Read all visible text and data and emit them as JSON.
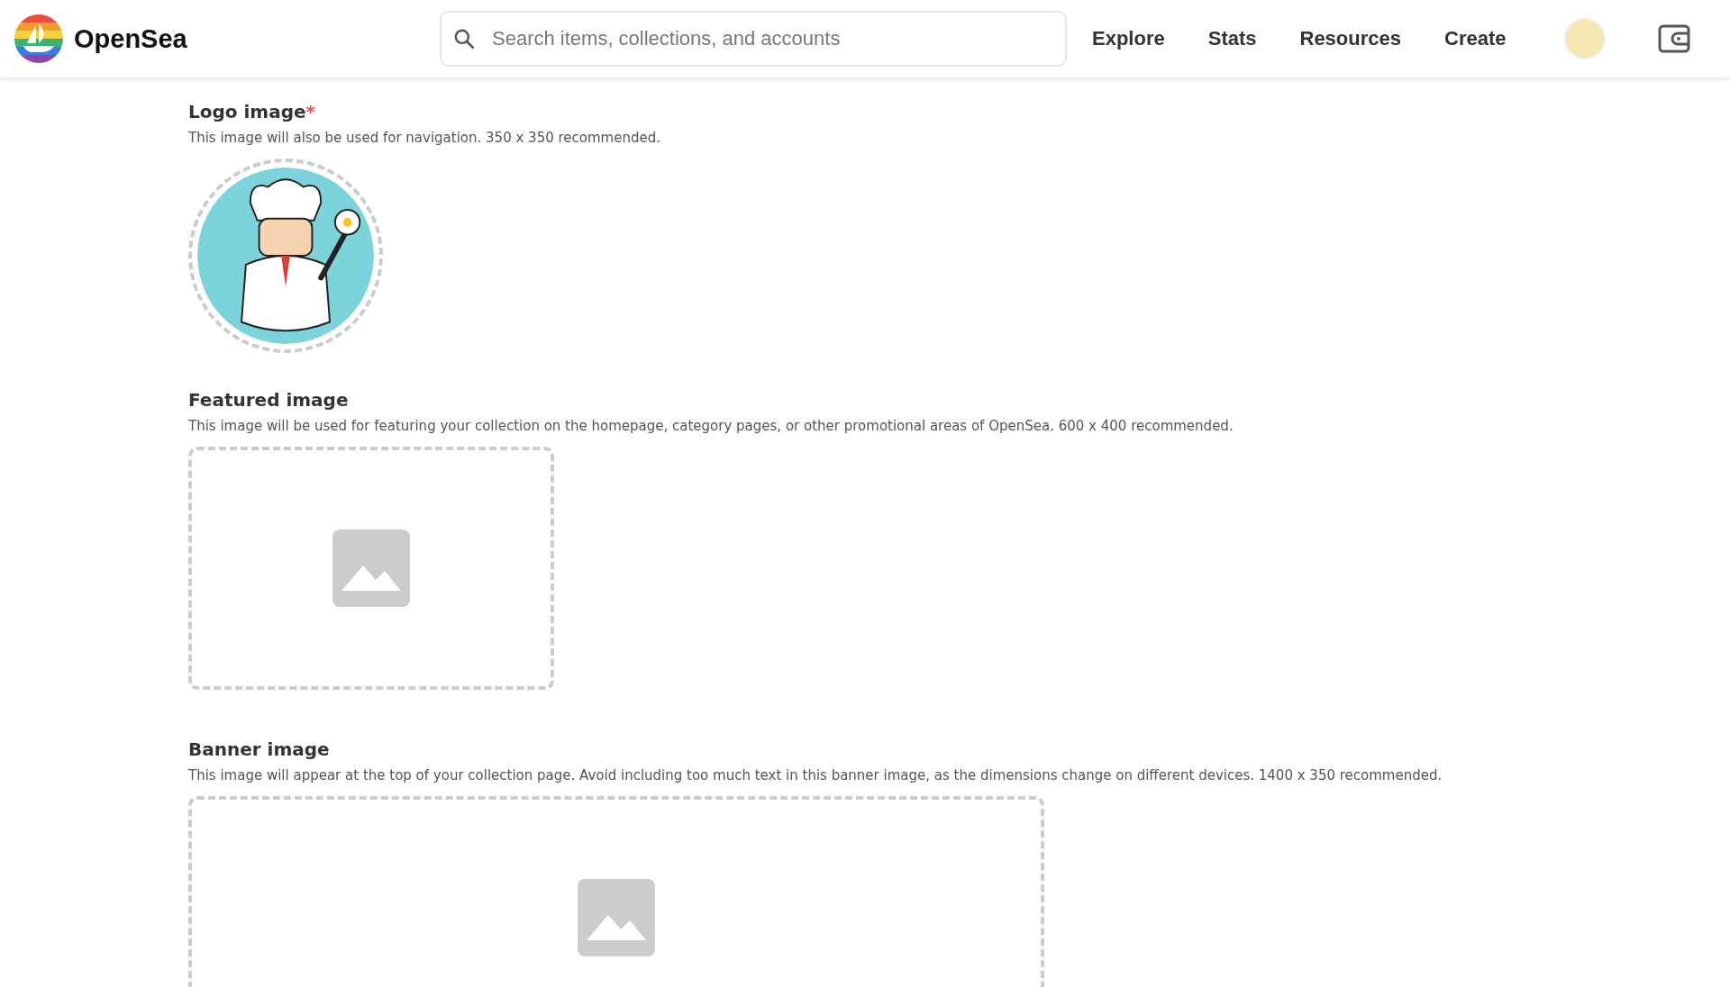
{
  "required_mark": "*",
  "header": {
    "brand": "OpenSea",
    "search": {
      "placeholder": "Search items, collections, and accounts"
    },
    "nav": [
      "Explore",
      "Stats",
      "Resources",
      "Create"
    ]
  },
  "sections": [
    {
      "kind": "logo",
      "title": "Logo image",
      "required": true,
      "description": "This image will also be used for navigation. 350 x 350 recommended.",
      "uploaded": true
    },
    {
      "kind": "featured",
      "title": "Featured image",
      "required": false,
      "description": "This image will be used for featuring your collection on the homepage, category pages, or other promotional areas of OpenSea. 600 x 400 recommended.",
      "uploaded": false
    },
    {
      "kind": "banner",
      "title": "Banner image",
      "required": false,
      "description": "This image will appear at the top of your collection page. Avoid including too much text in this banner image, as the dimensions change on different devices. 1400 x 350 recommended.",
      "uploaded": false
    }
  ]
}
